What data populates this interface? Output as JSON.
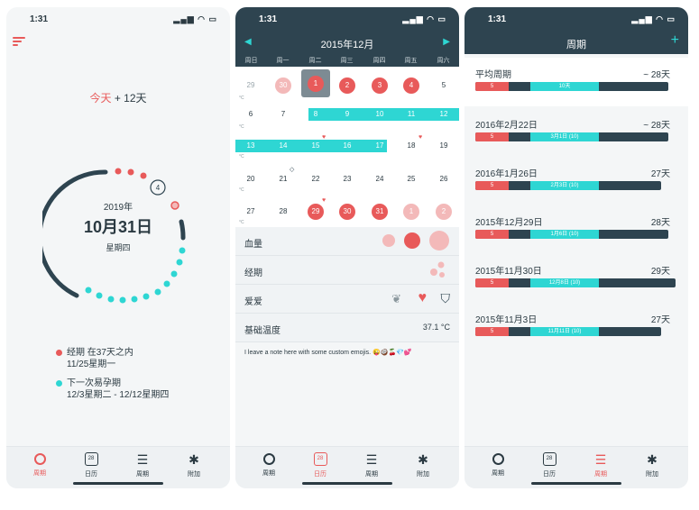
{
  "status_time": "1:31",
  "colors": {
    "accent_red": "#e85a5a",
    "accent_cyan": "#2ed6d3",
    "dark_header": "#2e4450"
  },
  "tabs": [
    {
      "label": "周期",
      "icon": "circle-icon"
    },
    {
      "label": "日历",
      "icon": "calendar-icon",
      "badge": "28"
    },
    {
      "label": "周期",
      "icon": "list-icon"
    },
    {
      "label": "附加",
      "icon": "gear-icon"
    }
  ],
  "screen1": {
    "today_label": "今天",
    "today_offset": "+ 12天",
    "ring_days": "4",
    "year": "2019年",
    "date": "10月31日",
    "weekday": "星期四",
    "legend": [
      {
        "line1": "经期 在37天之内",
        "line2": "11/25星期一",
        "color": "#e85a5a"
      },
      {
        "line1": "下一次易孕期",
        "line2": "12/3星期二 - 12/12星期四",
        "color": "#2ed6d3"
      }
    ]
  },
  "screen2": {
    "month": "2015年12月",
    "weekdays": [
      "周日",
      "周一",
      "周二",
      "周三",
      "周四",
      "周五",
      "周六"
    ],
    "weeks": [
      [
        "29",
        "30",
        "1",
        "2",
        "3",
        "4",
        "5"
      ],
      [
        "6",
        "7",
        "8",
        "9",
        "10",
        "11",
        "12"
      ],
      [
        "13",
        "14",
        "15",
        "16",
        "17",
        "18",
        "19"
      ],
      [
        "20",
        "21",
        "22",
        "23",
        "24",
        "25",
        "26"
      ],
      [
        "27",
        "28",
        "29",
        "30",
        "31",
        "1",
        "2"
      ]
    ],
    "deg_unit": "°C",
    "rows": [
      {
        "label": "血量"
      },
      {
        "label": "经期"
      },
      {
        "label": "爱爱"
      },
      {
        "label": "基础温度",
        "value": "37.1 °C"
      }
    ],
    "note": "I leave a note here with some custom emojis. 😜🥥🍒💎💕"
  },
  "screen3": {
    "title": "周期",
    "plus": "+",
    "cycles": [
      {
        "date": "平均周期",
        "length": "~ 28天",
        "period": "5",
        "fertile": "10天"
      },
      {
        "date": "2016年2月22日",
        "length": "~ 28天",
        "period": "5",
        "fertile": "3月1日 (10)"
      },
      {
        "date": "2016年1月26日",
        "length": "27天",
        "period": "5",
        "fertile": "2月3日 (10)"
      },
      {
        "date": "2015年12月29日",
        "length": "28天",
        "period": "5",
        "fertile": "1月6日 (10)"
      },
      {
        "date": "2015年11月30日",
        "length": "29天",
        "period": "5",
        "fertile": "12月8日 (10)"
      },
      {
        "date": "2015年11月3日",
        "length": "27天",
        "period": "5",
        "fertile": "11月11日 (10)"
      }
    ]
  }
}
